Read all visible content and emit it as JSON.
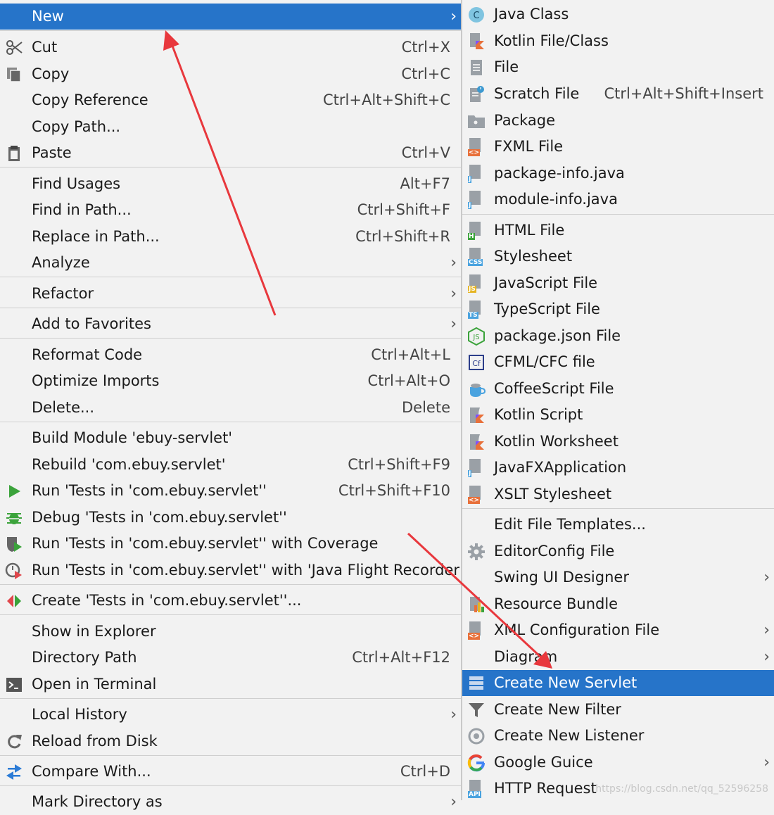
{
  "main_menu": {
    "new": "New",
    "cut": "Cut",
    "cut_sc": "Ctrl+X",
    "copy": "Copy",
    "copy_sc": "Ctrl+C",
    "copy_ref": "Copy Reference",
    "copy_ref_sc": "Ctrl+Alt+Shift+C",
    "copy_path": "Copy Path...",
    "paste": "Paste",
    "paste_sc": "Ctrl+V",
    "find_usages": "Find Usages",
    "find_usages_sc": "Alt+F7",
    "find_in_path": "Find in Path...",
    "find_in_path_sc": "Ctrl+Shift+F",
    "replace_in_path": "Replace in Path...",
    "replace_in_path_sc": "Ctrl+Shift+R",
    "analyze": "Analyze",
    "refactor": "Refactor",
    "add_favorites": "Add to Favorites",
    "reformat": "Reformat Code",
    "reformat_sc": "Ctrl+Alt+L",
    "optimize": "Optimize Imports",
    "optimize_sc": "Ctrl+Alt+O",
    "delete": "Delete...",
    "delete_sc": "Delete",
    "build_module": "Build Module 'ebuy-servlet'",
    "rebuild": "Rebuild 'com.ebuy.servlet'",
    "rebuild_sc": "Ctrl+Shift+F9",
    "run_tests": "Run 'Tests in 'com.ebuy.servlet''",
    "run_tests_sc": "Ctrl+Shift+F10",
    "debug_tests": "Debug 'Tests in 'com.ebuy.servlet''",
    "run_coverage": "Run 'Tests in 'com.ebuy.servlet'' with Coverage",
    "run_jfr": "Run 'Tests in 'com.ebuy.servlet'' with 'Java Flight Recorder'",
    "create_tests": "Create 'Tests in 'com.ebuy.servlet''...",
    "show_explorer": "Show in Explorer",
    "dir_path": "Directory Path",
    "dir_path_sc": "Ctrl+Alt+F12",
    "open_terminal": "Open in Terminal",
    "local_history": "Local History",
    "reload": "Reload from Disk",
    "compare": "Compare With...",
    "compare_sc": "Ctrl+D",
    "mark_dir": "Mark Directory as"
  },
  "sub_menu": {
    "java_class": "Java Class",
    "kotlin_file": "Kotlin File/Class",
    "file": "File",
    "scratch": "Scratch File",
    "scratch_sc": "Ctrl+Alt+Shift+Insert",
    "package": "Package",
    "fxml": "FXML File",
    "package_info": "package-info.java",
    "module_info": "module-info.java",
    "html": "HTML File",
    "stylesheet": "Stylesheet",
    "javascript": "JavaScript File",
    "typescript": "TypeScript File",
    "package_json": "package.json File",
    "cfml": "CFML/CFC file",
    "coffee": "CoffeeScript File",
    "kotlin_script": "Kotlin Script",
    "kotlin_worksheet": "Kotlin Worksheet",
    "javafx": "JavaFXApplication",
    "xslt": "XSLT Stylesheet",
    "edit_templates": "Edit File Templates...",
    "editorconfig": "EditorConfig File",
    "swing": "Swing UI Designer",
    "resource_bundle": "Resource Bundle",
    "xml_config": "XML Configuration File",
    "diagram": "Diagram",
    "new_servlet": "Create New Servlet",
    "new_filter": "Create New Filter",
    "new_listener": "Create New Listener",
    "guice": "Google Guice",
    "http_request": "HTTP Request"
  },
  "badges": {
    "css": "CSS",
    "js": "JS",
    "ts": "TS",
    "h": "H",
    "j": "J",
    "xml": "<>",
    "api": "API",
    "cf": "Cf"
  },
  "watermark": "https://blog.csdn.net/qq_52596258",
  "colors": {
    "selection": "#2674c9",
    "menu_bg": "#f2f2f2",
    "annotation": "#e8383d"
  }
}
